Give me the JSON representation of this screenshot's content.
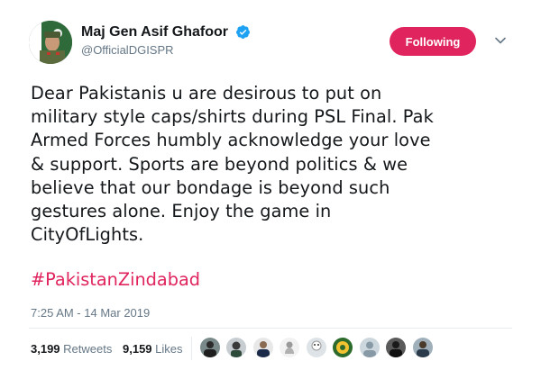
{
  "author": {
    "display_name": "Maj Gen Asif Ghafoor",
    "handle": "@OfficialDGISPR",
    "verified": true
  },
  "follow_button": {
    "label": "Following",
    "color": "#e0245e"
  },
  "tweet": {
    "text": "Dear Pakistanis u are desirous to put on\nmilitary style caps/shirts during PSL Final. Pak\nArmed Forces humbly acknowledge your love\n& support. Sports are beyond politics & we\nbelieve that our bondage is beyond such\ngestures alone. Enjoy the game in\nCityOfLights.",
    "hashtag": "#PakistanZindabad",
    "timestamp": "7:25 AM - 14 Mar 2019"
  },
  "stats": {
    "retweets_count": "3,199",
    "retweets_label": "Retweets",
    "likes_count": "9,159",
    "likes_label": "Likes"
  },
  "colors": {
    "hashtag": "#e0245e",
    "verified": "#1da1f2",
    "secondary_text": "#657786"
  },
  "likers": [
    {
      "name": "liker-avatar-1"
    },
    {
      "name": "liker-avatar-2"
    },
    {
      "name": "liker-avatar-3"
    },
    {
      "name": "liker-avatar-4"
    },
    {
      "name": "liker-avatar-5"
    },
    {
      "name": "liker-avatar-6"
    },
    {
      "name": "liker-avatar-7"
    },
    {
      "name": "liker-avatar-8"
    },
    {
      "name": "liker-avatar-9"
    }
  ]
}
